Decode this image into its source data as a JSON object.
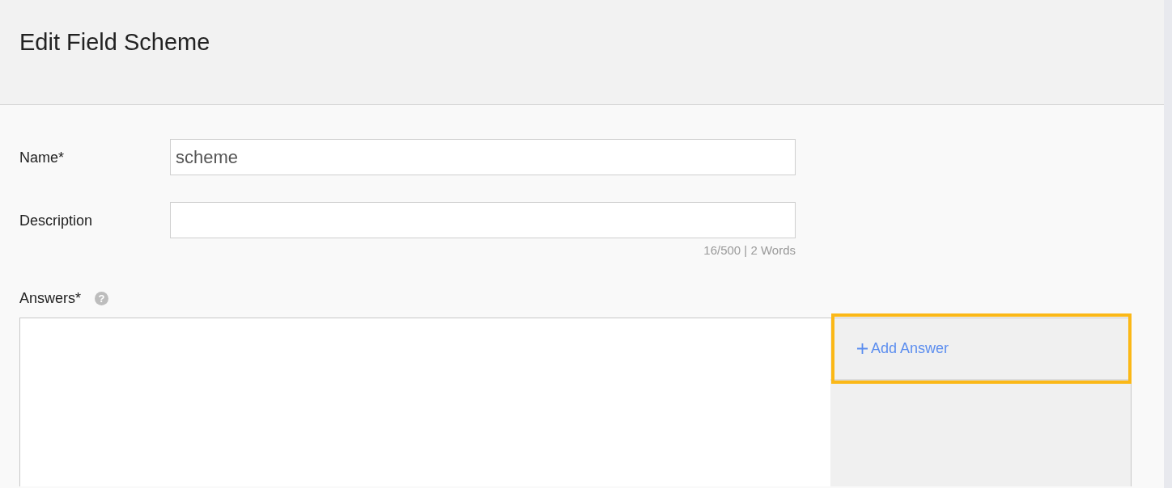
{
  "header": {
    "title": "Edit Field Scheme"
  },
  "fields": [
    {
      "label": "Name*",
      "value": "scheme"
    },
    {
      "label": "Description",
      "counter": "16/500 | 2 Words"
    }
  ],
  "answers": {
    "label": "Answers*",
    "help": "?",
    "add_button": {
      "label": "Add Answer",
      "highlighted": true
    }
  }
}
